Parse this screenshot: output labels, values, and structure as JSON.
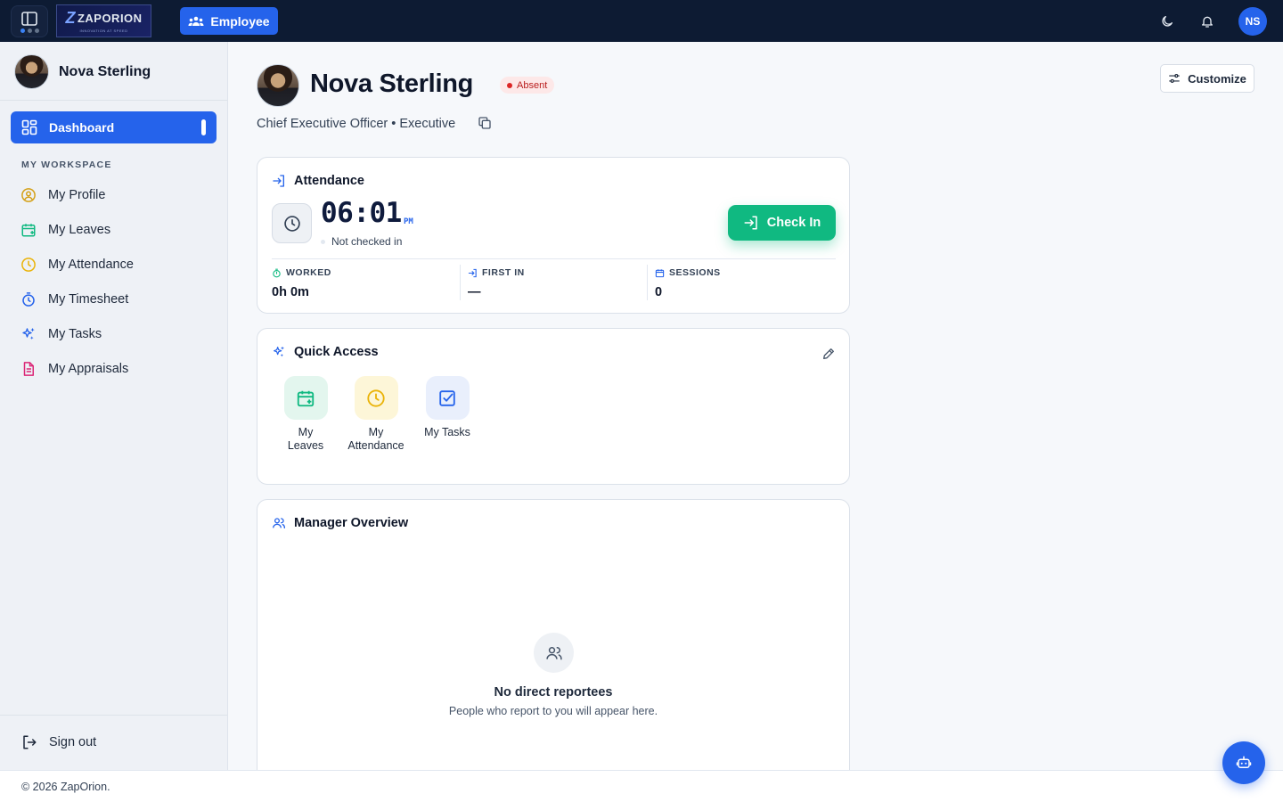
{
  "topbar": {
    "logo_brand": "ZAPORION",
    "logo_tagline": "INNOVATION AT SPEED",
    "role_button": "Employee",
    "avatar_initials": "NS"
  },
  "sidebar": {
    "user_name": "Nova Sterling",
    "active_item": "Dashboard",
    "section_label": "MY WORKSPACE",
    "items": [
      {
        "label": "My Profile",
        "icon": "user-circle-icon",
        "color": "#d4a017"
      },
      {
        "label": "My Leaves",
        "icon": "calendar-plus-icon",
        "color": "#10b981"
      },
      {
        "label": "My Attendance",
        "icon": "clock-icon",
        "color": "#eab308"
      },
      {
        "label": "My Timesheet",
        "icon": "stopwatch-icon",
        "color": "#2563eb"
      },
      {
        "label": "My Tasks",
        "icon": "sparkles-icon",
        "color": "#2563eb"
      },
      {
        "label": "My Appraisals",
        "icon": "document-icon",
        "color": "#db2777"
      }
    ],
    "signout": "Sign out"
  },
  "profile": {
    "name": "Nova Sterling",
    "status": "Absent",
    "subtitle": "Chief Executive Officer • Executive",
    "customize_label": "Customize"
  },
  "attendance": {
    "title": "Attendance",
    "time": "06:01",
    "ampm": "PM",
    "status": "Not checked in",
    "checkin_label": "Check In",
    "stats": [
      {
        "label": "WORKED",
        "value": "0h 0m"
      },
      {
        "label": "FIRST IN",
        "value": "—"
      },
      {
        "label": "SESSIONS",
        "value": "0"
      }
    ]
  },
  "quick_access": {
    "title": "Quick Access",
    "items": [
      {
        "label": "My Leaves",
        "icon": "calendar-plus-icon"
      },
      {
        "label": "My Attendance",
        "icon": "clock-icon"
      },
      {
        "label": "My Tasks",
        "icon": "checkbox-icon"
      }
    ]
  },
  "manager_overview": {
    "title": "Manager Overview",
    "empty_title": "No direct reportees",
    "empty_sub": "People who report to you will appear here."
  },
  "footer": {
    "copyright": "© 2026 ZapOrion."
  },
  "colors": {
    "primary": "#2563eb",
    "success": "#10b981",
    "danger": "#dc2626",
    "topbar": "#0d1b33"
  }
}
